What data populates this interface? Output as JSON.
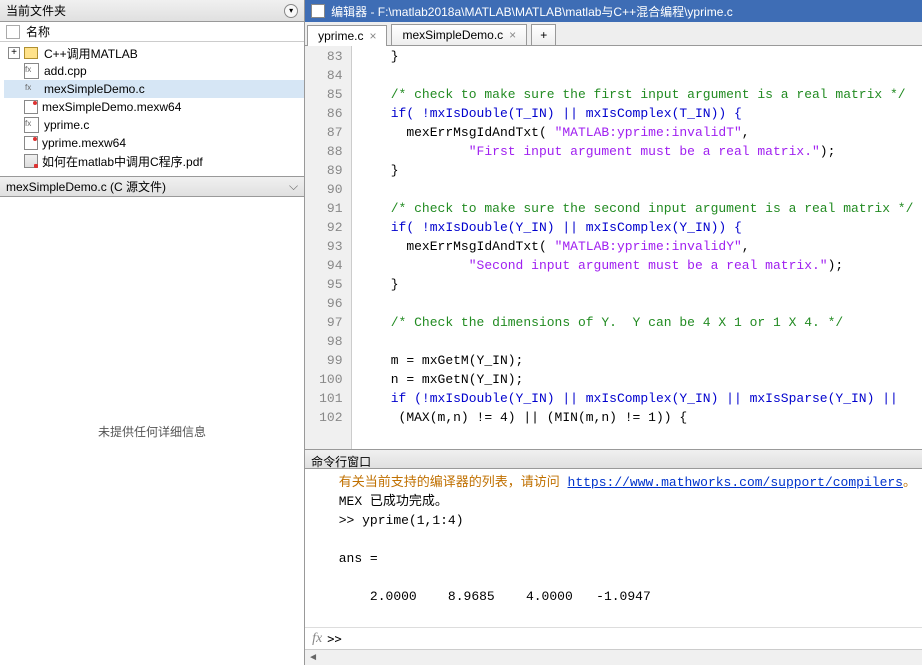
{
  "left": {
    "title": "当前文件夹",
    "name_col": "名称",
    "folder": "C++调用MATLAB",
    "files": [
      {
        "name": "add.cpp",
        "kind": "cpp"
      },
      {
        "name": "mexSimpleDemo.c",
        "kind": "cpp",
        "selected": true
      },
      {
        "name": "mexSimpleDemo.mexw64",
        "kind": "doc"
      },
      {
        "name": "yprime.c",
        "kind": "cpp"
      },
      {
        "name": "yprime.mexw64",
        "kind": "doc"
      },
      {
        "name": "如何在matlab中调用C程序.pdf",
        "kind": "pdf"
      }
    ],
    "sub_header": "mexSimpleDemo.c  (C 源文件)",
    "details_msg": "未提供任何详细信息"
  },
  "editor": {
    "title": "编辑器 - F:\\matlab2018a\\MATLAB\\MATLAB\\matlab与C++混合编程\\yprime.c",
    "tabs": [
      {
        "label": "yprime.c",
        "active": true
      },
      {
        "label": "mexSimpleDemo.c",
        "active": false
      }
    ],
    "plus": "+",
    "first_line": 83,
    "lines": {
      "l83": "    }",
      "l84": "",
      "l85c": "    /* check to make sure the first input argument is a real matrix */",
      "l86a": "    if( !mxIsDouble(T_IN) || mxIsComplex(T_IN)) {",
      "l87a": "      mexErrMsgIdAndTxt( ",
      "l87s": "\"MATLAB:yprime:invalidT\"",
      "l87b": ",",
      "l88s": "              \"First input argument must be a real matrix.\"",
      "l88b": ");",
      "l89": "    }",
      "l90": "",
      "l91c": "    /* check to make sure the second input argument is a real matrix */",
      "l92a": "    if( !mxIsDouble(Y_IN) || mxIsComplex(Y_IN)) {",
      "l93a": "      mexErrMsgIdAndTxt( ",
      "l93s": "\"MATLAB:yprime:invalidY\"",
      "l93b": ",",
      "l94s": "              \"Second input argument must be a real matrix.\"",
      "l94b": ");",
      "l95": "    }",
      "l96": "",
      "l97c": "    /* Check the dimensions of Y.  Y can be 4 X 1 or 1 X 4. */",
      "l98": "",
      "l99": "    m = mxGetM(Y_IN);",
      "l100": "    n = mxGetN(Y_IN);",
      "l101": "    if (!mxIsDouble(Y_IN) || mxIsComplex(Y_IN) || mxIsSparse(Y_IN) ||",
      "l102": "     (MAX(m,n) != 4) || (MIN(m,n) != 1)) {"
    }
  },
  "cmd": {
    "title": "命令行窗口",
    "hint_pre": "  有关当前支持的编译器的列表，请访问 ",
    "hint_link": "https://www.mathworks.com/support/compilers",
    "hint_post": "。",
    "done": "  MEX 已成功完成。",
    "call": "  >> yprime(1,1:4)",
    "ans_lbl": "  ans =",
    "ans_vals": "      2.0000    8.9685    4.0000   -1.0947",
    "prompt": ">> "
  }
}
